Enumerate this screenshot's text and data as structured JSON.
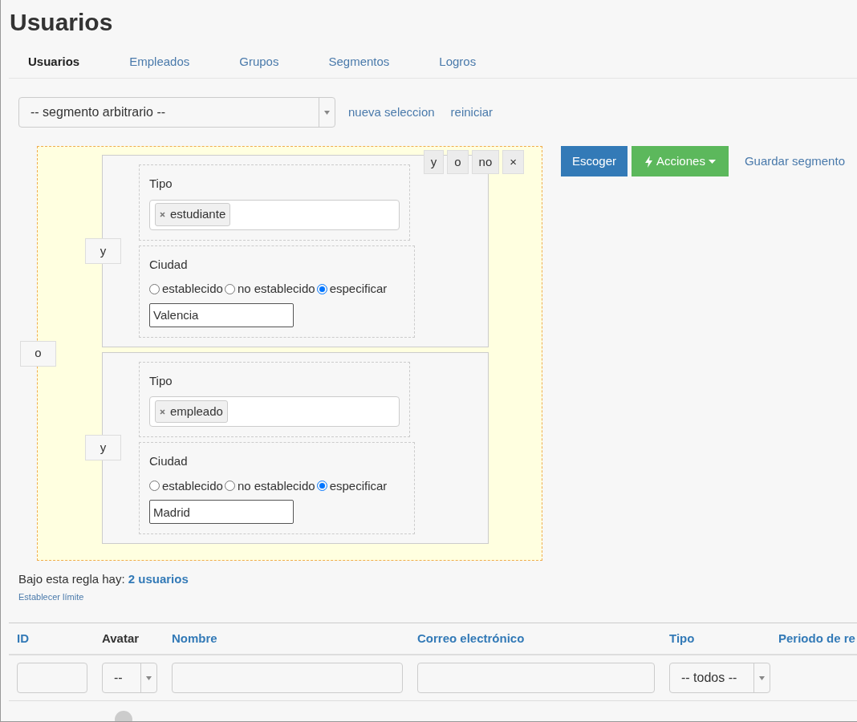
{
  "title": "Usuarios",
  "tabs": [
    {
      "label": "Usuarios",
      "selected": true
    },
    {
      "label": "Empleados",
      "selected": false
    },
    {
      "label": "Grupos",
      "selected": false
    },
    {
      "label": "Segmentos",
      "selected": false
    },
    {
      "label": "Logros",
      "selected": false
    }
  ],
  "segment_select": {
    "value": "-- segmento arbitrario --"
  },
  "segment_links": [
    "nueva seleccion",
    "reiniciar"
  ],
  "rule": {
    "operator_buttons": [
      "y",
      "o",
      "no",
      "×"
    ],
    "outer_operator": "o",
    "groups": [
      {
        "operator": "y",
        "conditions": [
          {
            "kind": "tags",
            "label": "Tipo",
            "tags": [
              "estudiante"
            ]
          },
          {
            "kind": "radio",
            "label": "Ciudad",
            "options": [
              {
                "label": "establecido",
                "selected": false
              },
              {
                "label": "no establecido",
                "selected": false
              },
              {
                "label": "especificar",
                "selected": true
              }
            ],
            "value": "Valencia"
          }
        ]
      },
      {
        "operator": "y",
        "conditions": [
          {
            "kind": "tags",
            "label": "Tipo",
            "tags": [
              "empleado"
            ]
          },
          {
            "kind": "radio",
            "label": "Ciudad",
            "options": [
              {
                "label": "establecido",
                "selected": false
              },
              {
                "label": "no establecido",
                "selected": false
              },
              {
                "label": "especificar",
                "selected": true
              }
            ],
            "value": "Madrid"
          }
        ]
      }
    ]
  },
  "actions": {
    "choose": "Escoger",
    "menu": "Acciones",
    "save": "Guardar segmento"
  },
  "summary": {
    "text": "Bajo esta regla hay:",
    "count": "2 usuarios",
    "limit_link": "Establecer límite"
  },
  "table": {
    "columns": [
      {
        "label": "ID",
        "sortable": true
      },
      {
        "label": "Avatar",
        "sortable": false
      },
      {
        "label": "Nombre",
        "sortable": true
      },
      {
        "label": "Correo electrónico",
        "sortable": true
      },
      {
        "label": "Tipo",
        "sortable": true
      },
      {
        "label": "Periodo de re",
        "sortable": true
      }
    ],
    "filters": [
      {
        "kind": "input"
      },
      {
        "kind": "select",
        "value": "--"
      },
      {
        "kind": "input"
      },
      {
        "kind": "input"
      },
      {
        "kind": "select",
        "value": "-- todos --"
      },
      {
        "kind": "none"
      }
    ]
  }
}
